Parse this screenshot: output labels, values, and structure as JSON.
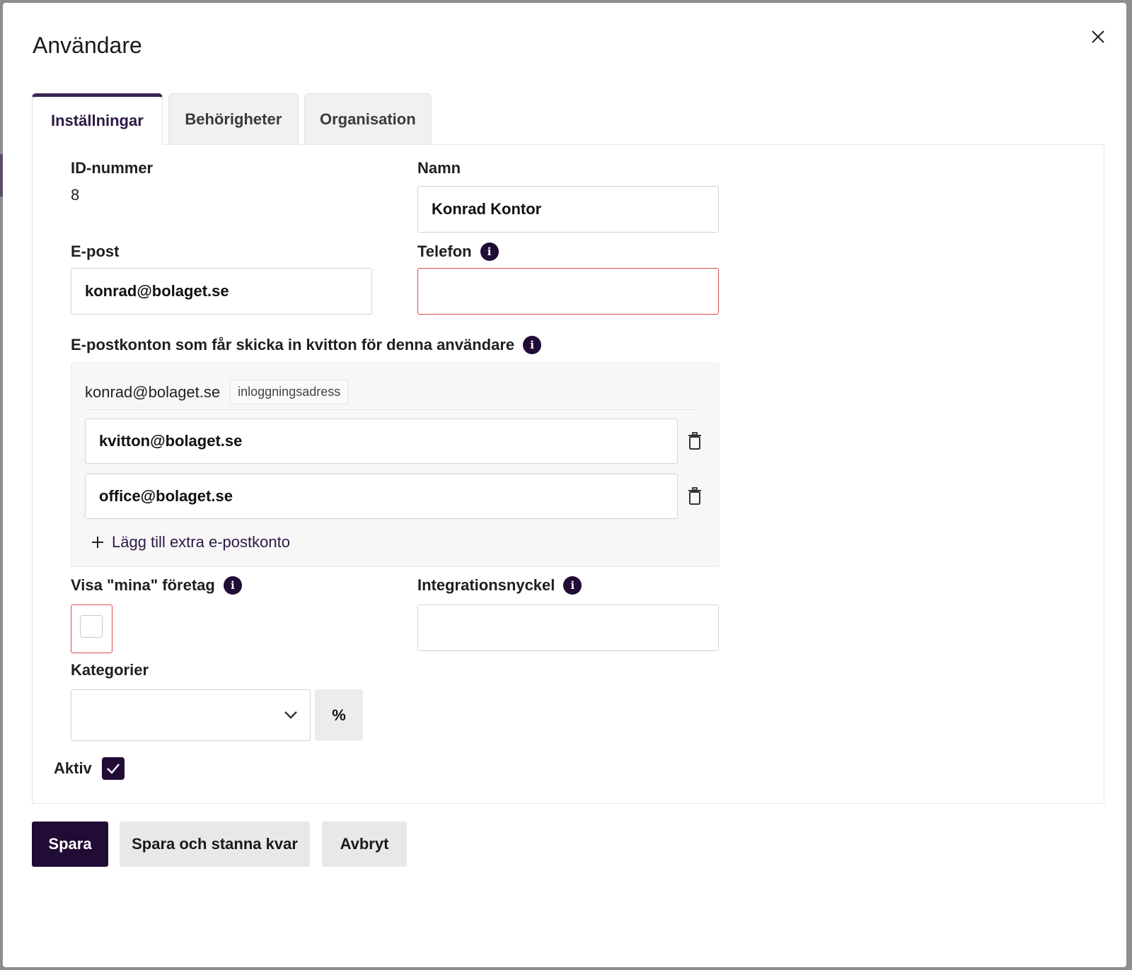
{
  "dialog": {
    "title": "Användare"
  },
  "tabs": [
    {
      "label": "Inställningar",
      "active": true
    },
    {
      "label": "Behörigheter",
      "active": false
    },
    {
      "label": "Organisation",
      "active": false
    }
  ],
  "form": {
    "id_label": "ID-nummer",
    "id_value": "8",
    "name_label": "Namn",
    "name_value": "Konrad Kontor",
    "email_label": "E-post",
    "email_value": "konrad@bolaget.se",
    "phone_label": "Telefon",
    "phone_value": "",
    "receipt_accounts_label": "E-postkonton som får skicka in kvitton för denna användare",
    "login_email": "konrad@bolaget.se",
    "login_tag": "inloggningsadress",
    "extra_accounts": [
      "kvitton@bolaget.se",
      "office@bolaget.se"
    ],
    "add_account_label": "Lägg till extra e-postkonto",
    "show_mine_label": "Visa \"mina\" företag",
    "show_mine_checked": false,
    "integration_label": "Integrationsnyckel",
    "integration_value": "",
    "categories_label": "Kategorier",
    "categories_value": "",
    "percent_label": "%",
    "active_label": "Aktiv",
    "active_checked": true
  },
  "actions": {
    "save": "Spara",
    "save_stay": "Spara och stanna kvar",
    "cancel": "Avbryt"
  },
  "colors": {
    "primary": "#210c36",
    "error_border": "#e04a4a"
  }
}
